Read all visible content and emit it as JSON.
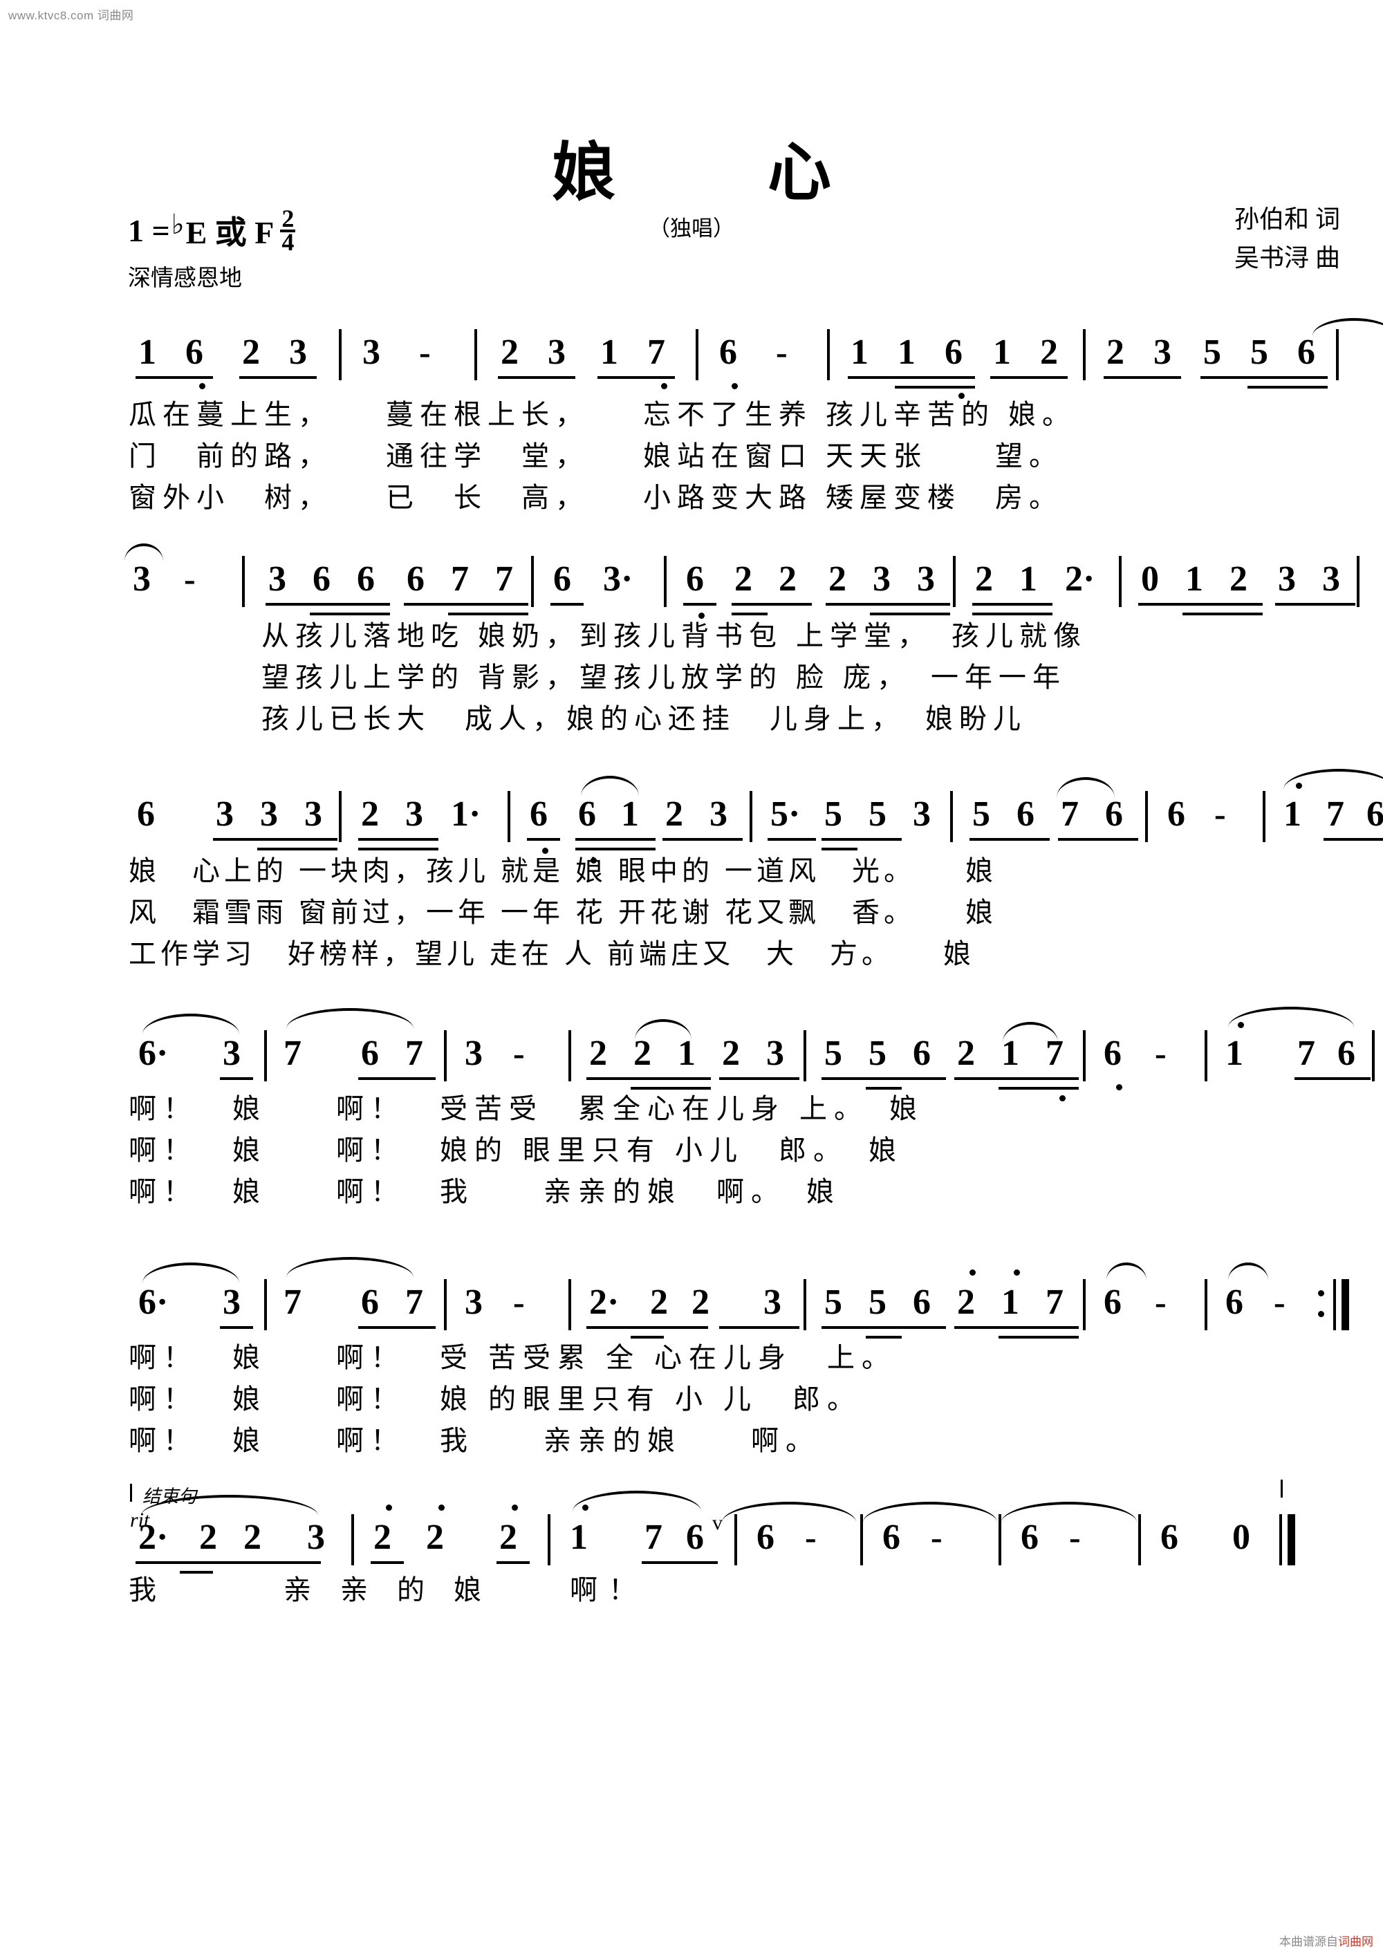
{
  "watermarks": {
    "top_left": "www.ktvc8.com 词曲网",
    "bottom_right_label": "本曲谱源自",
    "bottom_right_site": "词曲网"
  },
  "header": {
    "title": "娘　心",
    "subtitle": "（独唱）",
    "key_prefix": "1 =",
    "key_flat": "♭",
    "key_names": "E 或 F",
    "meter_numerator": "2",
    "meter_denominator": "4",
    "expression": "深情感恩地",
    "lyricist": "孙伯和 词",
    "composer": "吴书浔 曲"
  },
  "score": {
    "type": "jianpu",
    "systems": [
      {
        "id": "system-1",
        "notes": "1 6 2 3 | 3 - | 2 3 1 7 | 6 - | 1 1 6 1 2 | 2 3 5 5 6 | 3 -",
        "lyrics": [
          "瓜在蔓上生，　　蔓在根上长，　　忘不了生养 孩儿辛苦的 娘。",
          "门　前的路，　　通往学　堂，　　娘站在窗口 天天张　　望。",
          "窗外小　树，　　已　长　高，　　小路变大路 矮屋变楼　房。"
        ]
      },
      {
        "id": "system-2",
        "notes": "3 - | 3 6 6 6 7 7 | 6 3· | 6 2 2 2 3 3 | 2 1 2· | 0 1 2 3 3",
        "lyrics": [
          "从孩儿落地吃 娘奶，到孩儿背书包 上学堂，　孩儿就像",
          "望孩儿上学的 背影，望孩儿放学的 脸 庞，　一年一年",
          "孩儿已长大　成人，娘的心还挂　儿身上，　娘盼儿"
        ]
      },
      {
        "id": "system-3",
        "notes": "6 3 3 3 | 2 3 1· | 6 6 1 2 3 | 5· 5 5 3 | 5 6 7 6 | 6 - | 1' 7 6",
        "lyrics": [
          "娘　心上的 一块肉，孩儿 就是 娘 眼中的 一道风　光。　　娘",
          "风　霜雪雨 窗前过，一年 一年 花 开花谢 花又飘　香。　　娘",
          "工作学习　好榜样，望儿 走在 人 前端庄又　大　方。　　娘"
        ]
      },
      {
        "id": "system-4",
        "notes": "6· 3 | 7 6 7 | 3 - | 2 2 1 2 3 | 5 5 6 2 1 7 | 6 - | 1' 7 6",
        "lyrics": [
          "啊！　娘　　啊！　受苦受　累全心在儿身 上。　娘",
          "啊！　娘　　啊！　娘的 眼里只有 小儿　郎。　娘",
          "啊！　娘　　啊！　我　　亲亲的娘　啊。　娘"
        ]
      },
      {
        "id": "system-5",
        "notes": "6· 3 | 7 6 7 | 3 - | 2· 2 2 3 | 5 5 6 2' 1' 7 | 6 - | 6 - :||",
        "lyrics": [
          "啊！　娘　　啊！　受 苦受累 全 心在儿身　上。",
          "啊！　娘　　啊！　娘 的眼里只有 小 儿　郎。",
          "啊！　娘　　啊！　我　　亲亲的娘　　啊。"
        ]
      },
      {
        "id": "system-6-coda",
        "coda_label": "结束句",
        "tempo_mark": "rit",
        "breath_mark": "v",
        "notes": "2· 2 2 3 | 2' 2' 2' | 1' 7 6 | 6 - | 6 - | 6 - | 6 0 ||",
        "lyrics": [
          "我　　　亲 亲 的 娘　　啊！"
        ]
      }
    ]
  }
}
